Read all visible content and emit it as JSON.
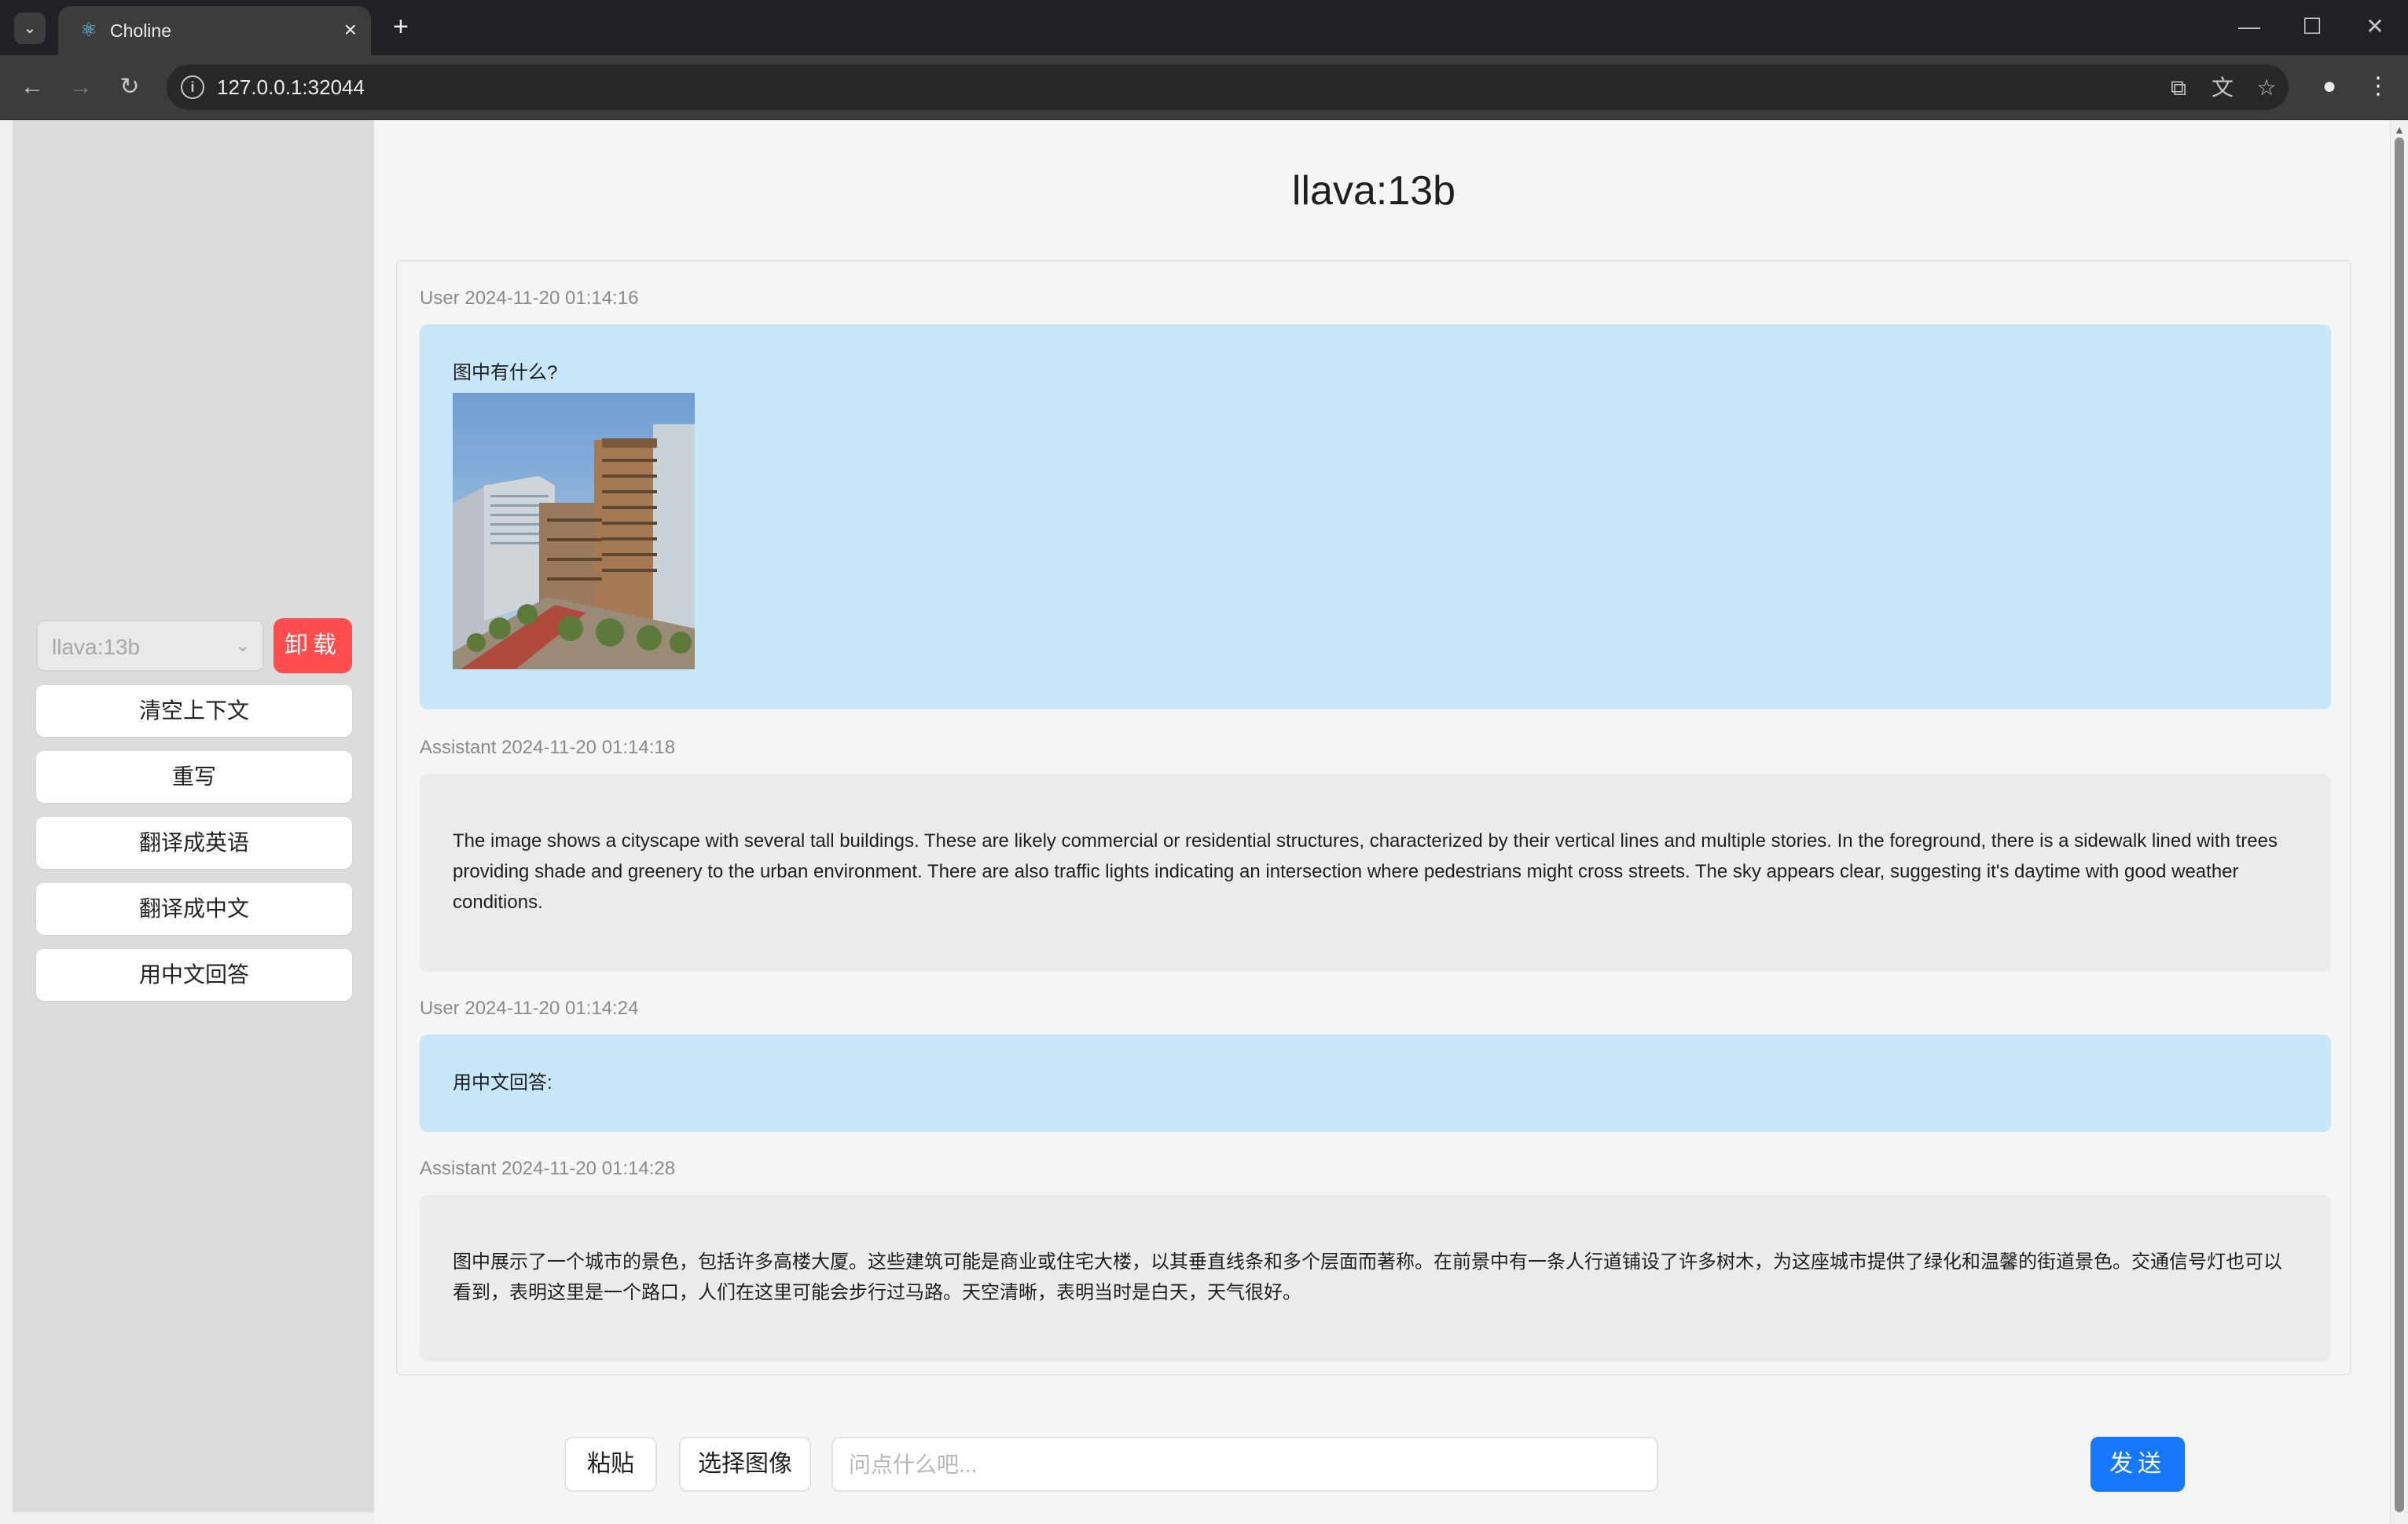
{
  "browser": {
    "tab_title": "Choline",
    "tab_close": "×",
    "new_tab": "+",
    "url": "127.0.0.1:32044",
    "window_controls": {
      "minimize": "—",
      "maximize": "☐",
      "close": "✕"
    }
  },
  "sidebar": {
    "model_select": {
      "value": "llava:13b",
      "chevron": "⌄"
    },
    "unload_label": "卸载",
    "buttons": [
      "清空上下文",
      "重写",
      "翻译成英语",
      "翻译成中文",
      "用中文回答"
    ]
  },
  "chat": {
    "model_title": "llava:13b",
    "messages": [
      {
        "role": "User",
        "timestamp": "User 2024-11-20 01:14:16",
        "text": "图中有什么?",
        "has_image": true
      },
      {
        "role": "Assistant",
        "timestamp": "Assistant 2024-11-20 01:14:18",
        "text": "The image shows a cityscape with several tall buildings. These are likely commercial or residential structures, characterized by their vertical lines and multiple stories. In the foreground, there is a sidewalk lined with trees providing shade and greenery to the urban environment. There are also traffic lights indicating an intersection where pedestrians might cross streets. The sky appears clear, suggesting it's daytime with good weather conditions."
      },
      {
        "role": "User",
        "timestamp": "User 2024-11-20 01:14:24",
        "text": "用中文回答:"
      },
      {
        "role": "Assistant",
        "timestamp": "Assistant 2024-11-20 01:14:28",
        "text": "图中展示了一个城市的景色，包括许多高楼大厦。这些建筑可能是商业或住宅大楼，以其垂直线条和多个层面而著称。在前景中有一条人行道铺设了许多树木，为这座城市提供了绿化和温馨的街道景色。交通信号灯也可以看到，表明这里是一个路口，人们在这里可能会步行过马路。天空清晰，表明当时是白天，天气很好。"
      }
    ]
  },
  "input_bar": {
    "paste_label": "粘贴",
    "choose_image_label": "选择图像",
    "placeholder": "问点什么吧...",
    "send_label": "发送"
  },
  "colors": {
    "user_bubble": "#c8e6fa",
    "assistant_bubble": "#ebebeb",
    "unload_button": "#ff4d4f",
    "send_button": "#1677ff"
  }
}
